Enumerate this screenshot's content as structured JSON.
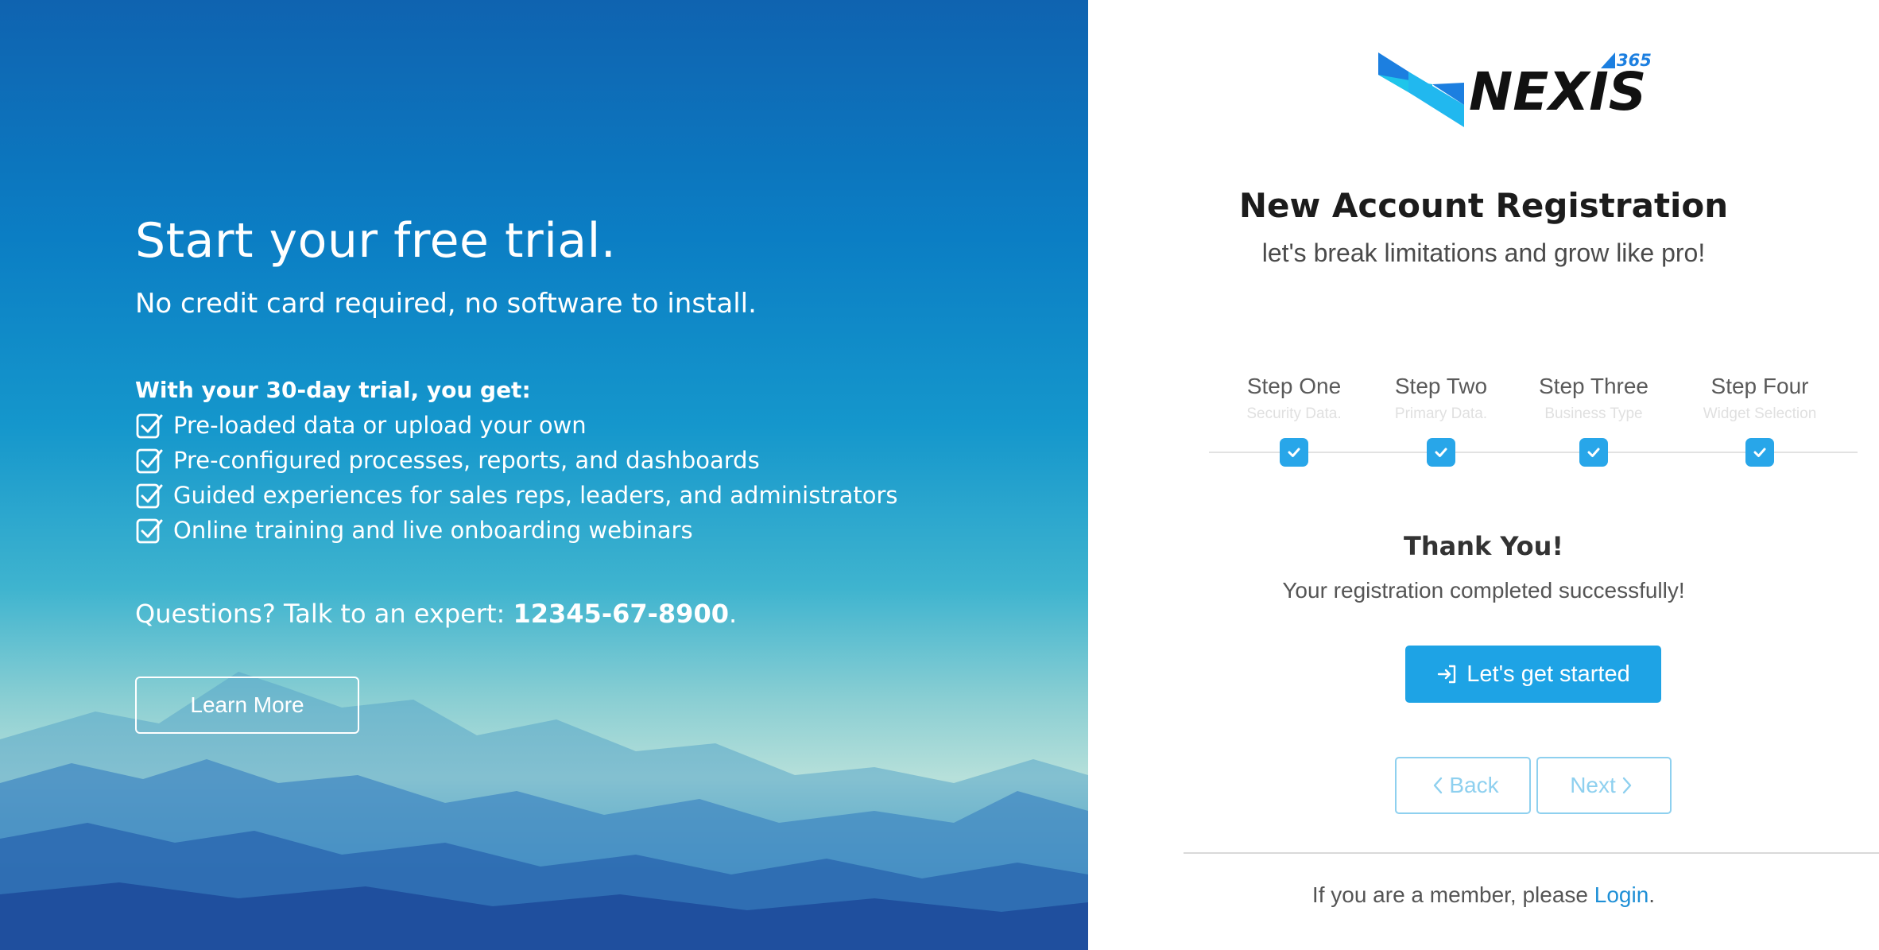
{
  "hero": {
    "title": "Start your free trial.",
    "subtitle": "No credit card required, no software to install.",
    "trial_heading": "With your 30-day trial, you get:",
    "features": [
      "Pre-loaded data or upload your own",
      "Pre-configured processes, reports, and dashboards",
      "Guided experiences for sales reps, leaders, and administrators",
      "Online training and live onboarding webinars"
    ],
    "questions_prefix": "Questions? Talk to an expert: ",
    "phone": "12345-67-8900",
    "questions_suffix": ".",
    "learn_more_label": "Learn More"
  },
  "brand": {
    "logo_text": "NEXIS",
    "logo_badge": "365",
    "accent": "#1ea3e5"
  },
  "registration": {
    "title": "New Account Registration",
    "subtitle": "let's break limitations and grow like pro!",
    "steps": [
      {
        "title": "Step One",
        "subtitle": "Security Data.",
        "completed": true
      },
      {
        "title": "Step Two",
        "subtitle": "Primary Data.",
        "completed": true
      },
      {
        "title": "Step Three",
        "subtitle": "Business Type",
        "completed": true
      },
      {
        "title": "Step Four",
        "subtitle": "Widget Selection",
        "completed": true
      }
    ],
    "thanks_title": "Thank You!",
    "thanks_message": "Your registration completed successfully!",
    "start_button": "Let's get started",
    "back_button": "Back",
    "next_button": "Next",
    "member_prefix": "If you are a member, please ",
    "login_link": "Login",
    "member_suffix": "."
  },
  "icons": {
    "feature_check": "checkbox-check-icon",
    "step_check": "check-icon",
    "start": "sign-in-icon",
    "back": "chevron-left-icon",
    "next": "chevron-right-icon"
  }
}
